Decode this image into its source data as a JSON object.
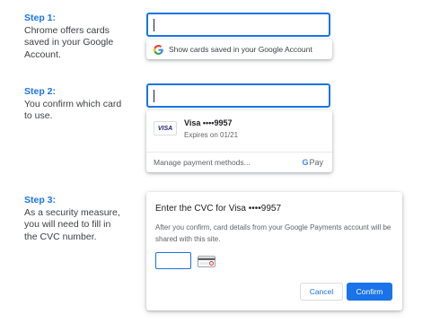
{
  "steps": [
    {
      "title": "Step 1:",
      "text": "Chrome offers cards saved in your Google Account."
    },
    {
      "title": "Step 2:",
      "text": "You confirm which card to use."
    },
    {
      "title": "Step 3:",
      "text": "As a security measure, you will need to fill in the CVC number."
    }
  ],
  "step1": {
    "suggestion": "Show cards saved in your Google Account"
  },
  "step2": {
    "card_logo": "VISA",
    "card_name": "Visa  ••••9957",
    "expiry": "Expires on 01/21",
    "manage": "Manage payment methods...",
    "gpay_g": "G",
    "gpay_pay": "Pay"
  },
  "step3": {
    "title": "Enter the CVC for Visa  ••••9957",
    "body": "After you confirm, card details from your Google Payments account will be shared with this site.",
    "cancel": "Cancel",
    "confirm": "Confirm"
  },
  "colors": {
    "accent": "#1a73e8",
    "text": "#3c4043"
  },
  "icons": [
    "google-g-icon",
    "visa-card-icon",
    "google-pay-icon",
    "cvc-card-back-icon"
  ]
}
